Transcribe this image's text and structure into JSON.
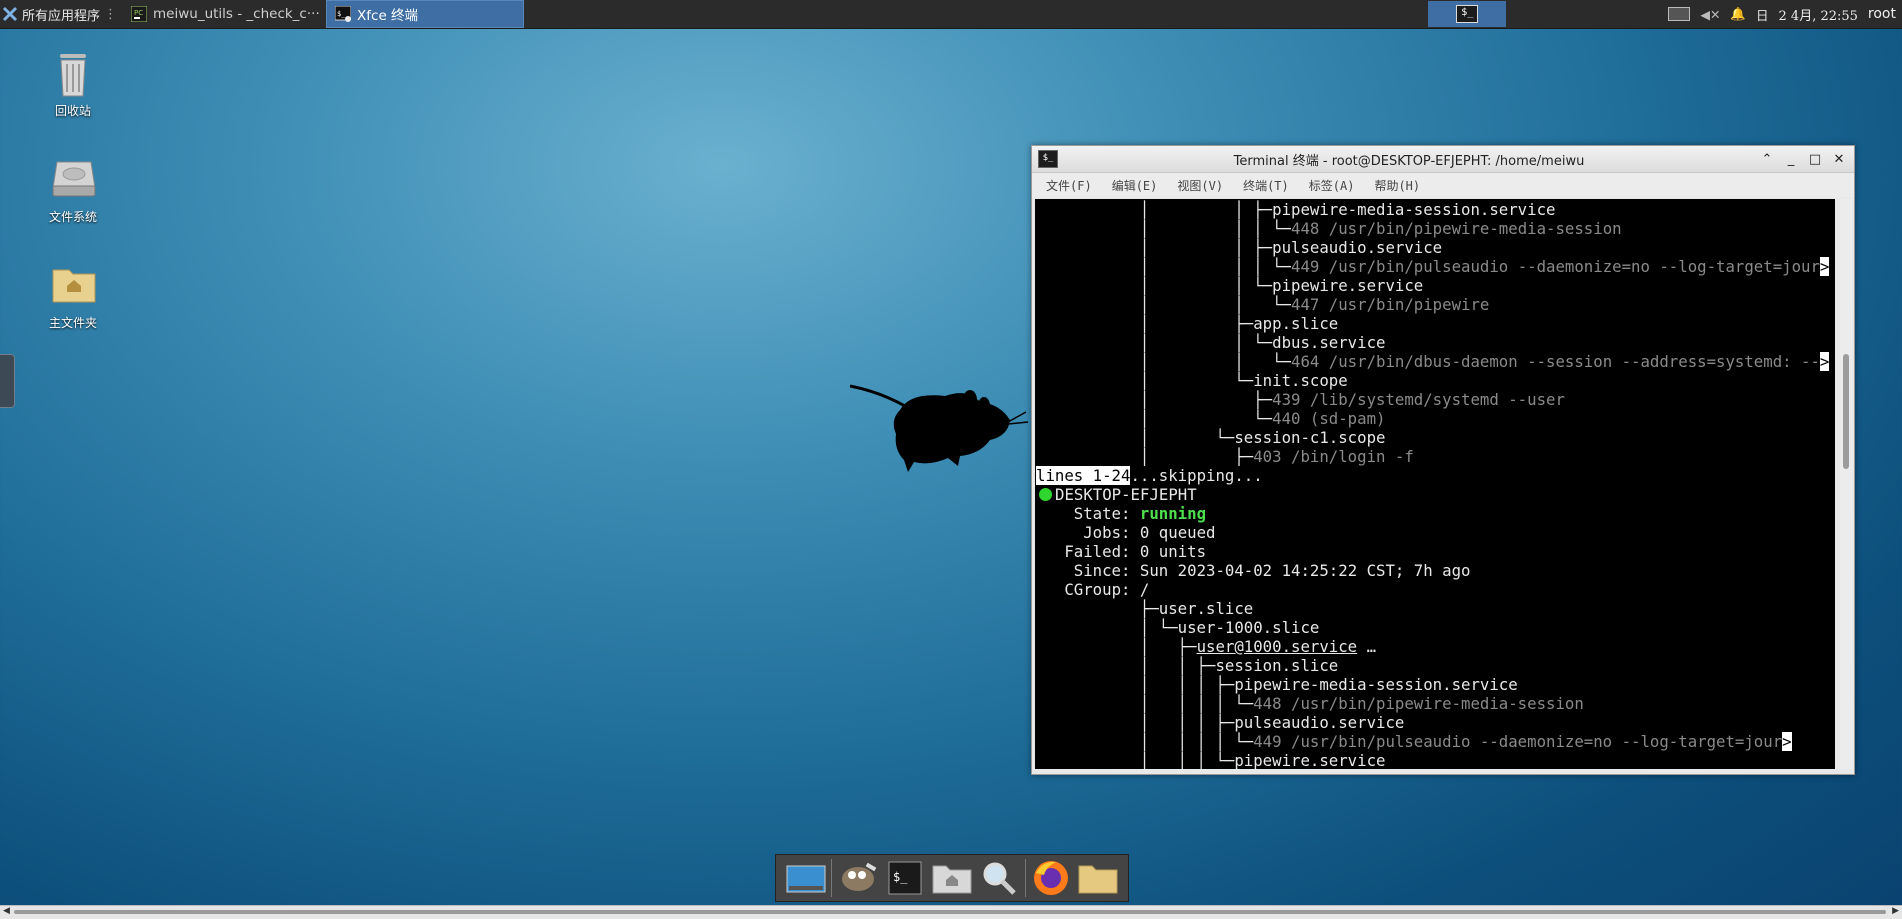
{
  "top_panel": {
    "apps_menu_label": "所有应用程序",
    "tasks": [
      {
        "label": "meiwu_utils - _check_c···",
        "active": false
      },
      {
        "label": "Xfce 终端",
        "active": true
      }
    ],
    "pager_glyph": "$_",
    "tray_date_icon": "日",
    "clock": "2 4月, 22:55",
    "user": "root"
  },
  "desktop_icons": [
    {
      "label": "回收站",
      "icon": "trash-icon"
    },
    {
      "label": "文件系统",
      "icon": "drive-icon"
    },
    {
      "label": "主文件夹",
      "icon": "home-folder-icon"
    }
  ],
  "terminal": {
    "title": "Terminal 终端 - root@DESKTOP-EFJEPHT: /home/meiwu",
    "menu": [
      "文件(F)",
      "编辑(E)",
      "视图(V)",
      "终端(T)",
      "标签(A)",
      "帮助(H)"
    ],
    "lines": {
      "l1": "pipewire-media-session.service",
      "l2": "448 /usr/bin/pipewire-media-session",
      "l3": "pulseaudio.service",
      "l4": "449 /usr/bin/pulseaudio --daemonize=no --log-target=jour",
      "l5": "pipewire.service",
      "l6": "447 /usr/bin/pipewire",
      "l7": "app.slice",
      "l8": "dbus.service",
      "l9": "464 /usr/bin/dbus-daemon --session --address=systemd: --",
      "l10": "init.scope",
      "l11": "439 /lib/systemd/systemd --user",
      "l12": "440 (sd-pam)",
      "l13": "session-c1.scope",
      "l14": "403 /bin/login -f",
      "l15_inv": "lines 1-24",
      "l15_rest": "...skipping...",
      "host": "DESKTOP-EFJEPHT",
      "state_label": "State:",
      "state_value": "running",
      "jobs_label": "Jobs:",
      "jobs_value": "0 queued",
      "failed_label": "Failed:",
      "failed_value": "0 units",
      "since_label": "Since:",
      "since_value": "Sun 2023-04-02 14:25:22 CST; 7h ago",
      "cgroup_label": "CGroup:",
      "cgroup_value": "/",
      "t1": "user.slice",
      "t2": "user-1000.slice",
      "t3": "user@1000.service",
      "t3_more": "…",
      "t4": "session.slice",
      "t5": "pipewire-media-session.service",
      "t6": "448 /usr/bin/pipewire-media-session",
      "t7": "pulseaudio.service",
      "t8": "449 /usr/bin/pulseaudio --daemonize=no --log-target=jour",
      "t9": "pipewire.service"
    }
  },
  "dock": [
    "show-desktop",
    "gimp",
    "terminal",
    "home-folder",
    "search",
    "firefox",
    "file-manager"
  ]
}
